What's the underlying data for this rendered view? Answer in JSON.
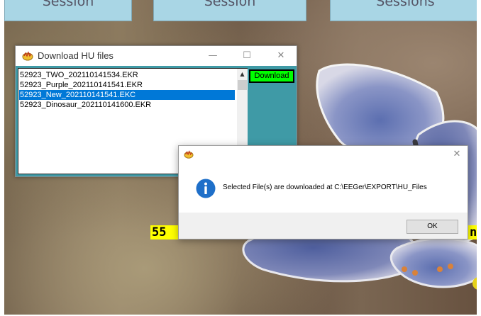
{
  "background": {
    "description_colors": [
      "#6d5c48",
      "#8e7a62",
      "#a99a78"
    ]
  },
  "sessions": [
    {
      "label": "Session"
    },
    {
      "label": "Session"
    },
    {
      "label": "Sessions"
    }
  ],
  "overlay_labels": {
    "left": "55",
    "right": "n"
  },
  "download_window": {
    "title": "Download HU files",
    "controls": {
      "minimize": "—",
      "maximize": "☐",
      "close": "✕"
    },
    "files": [
      {
        "name": "52923_TWO_202110141534.EKR",
        "selected": false
      },
      {
        "name": "52923_Purple_202110141541.EKR",
        "selected": false
      },
      {
        "name": "52923_New_202110141541.EKC",
        "selected": true
      },
      {
        "name": "52923_Dinosaur_202110141600.EKR",
        "selected": false
      }
    ],
    "download_button": "Download",
    "colors": {
      "client": "#3f9aa6",
      "download_button": "#00ff00",
      "selection": "#0078d7"
    }
  },
  "message_box": {
    "close": "✕",
    "icon": "info-icon",
    "message": "Selected File(s) are downloaded at C:\\EEGer\\EXPORT\\HU_Files",
    "ok_button": "OK"
  }
}
